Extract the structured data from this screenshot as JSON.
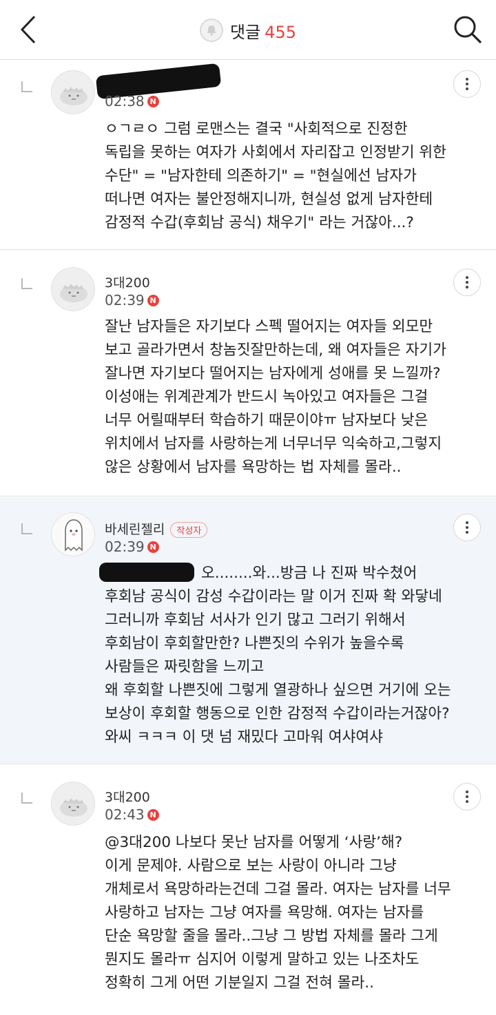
{
  "header": {
    "title": "댓글",
    "count": "455"
  },
  "comments": [
    {
      "author": "",
      "time": "02:38",
      "new_badge": "N",
      "lines": [
        "ㅇㄱㄹㅇ 그럼 로맨스는 결국 \"사회적으로 진정한",
        "독립을 못하는 여자가 사회에서 자리잡고 인정받기 위한",
        "수단\" = \"남자한테 의존하기\" = \"현실에선 남자가",
        "떠나면 여자는 불안정해지니까, 현실성 없게 남자한테",
        "감정적 수갑(후회남 공식) 채우기\" 라는 거잖아...?"
      ]
    },
    {
      "author": "3대200",
      "time": "02:39",
      "new_badge": "N",
      "lines": [
        "잘난 남자들은 자기보다 스펙 떨어지는 여자들 외모만",
        "보고 골라가면서 창놈짓잘만하는데, 왜 여자들은 자기가",
        "잘나면 자기보다 떨어지는 남자에게 성애를 못 느낄까?",
        "이성애는 위계관계가 반드시 녹아있고 여자들은 그걸",
        "너무 어릴때부터 학습하기 때문이야ㅠ 남자보다 낮은",
        "위치에서 남자를 사랑하는게 너무너무 익숙하고,그렇지",
        "않은 상황에서 남자를 욕망하는 법 자체를 몰라.."
      ]
    },
    {
      "author": "바세린젤리",
      "author_badge": "작성자",
      "time": "02:39",
      "new_badge": "N",
      "lines": [
        "오........와...방금 나 진짜 박수쳤어",
        "후회남 공식이 감성 수갑이라는 말 이거 진짜 확 와닿네",
        "그러니까 후회남 서사가 인기 많고 그러기 위해서",
        "후회남이 후회할만한? 나쁜짓의 수위가 높을수록",
        "사람들은 짜릿함을 느끼고",
        "왜 후회할 나쁜짓에 그렇게 열광하나 싶으면 거기에 오는",
        "보상이 후회할 행동으로 인한 감정적 수갑이라는거잖아?",
        "와씨 ㅋㅋㅋ 이 댓 넘 재밌다 고마워 여샤여샤"
      ]
    },
    {
      "author": "3대200",
      "time": "02:43",
      "new_badge": "N",
      "mention": "@3대200",
      "first_line_rest": " 나보다 못난 남자를 어떻게 ‘사랑’해?",
      "lines": [
        "이게 문제야. 사람으로 보는 사랑이 아니라 그냥",
        "개체로서 욕망하라는건데 그걸 몰라. 여자는 남자를 너무",
        "사랑하고 남자는 그냥 여자를 욕망해. 여자는 남자를",
        "단순 욕망할 줄을 몰라..그냥 그 방법 자체를 몰라 그게",
        "뭔지도 몰라ㅠ 심지어 이렇게 말하고 있는 나조차도",
        "정확히 그게 어떤 기분일지 그걸 전혀 몰라.."
      ]
    }
  ]
}
